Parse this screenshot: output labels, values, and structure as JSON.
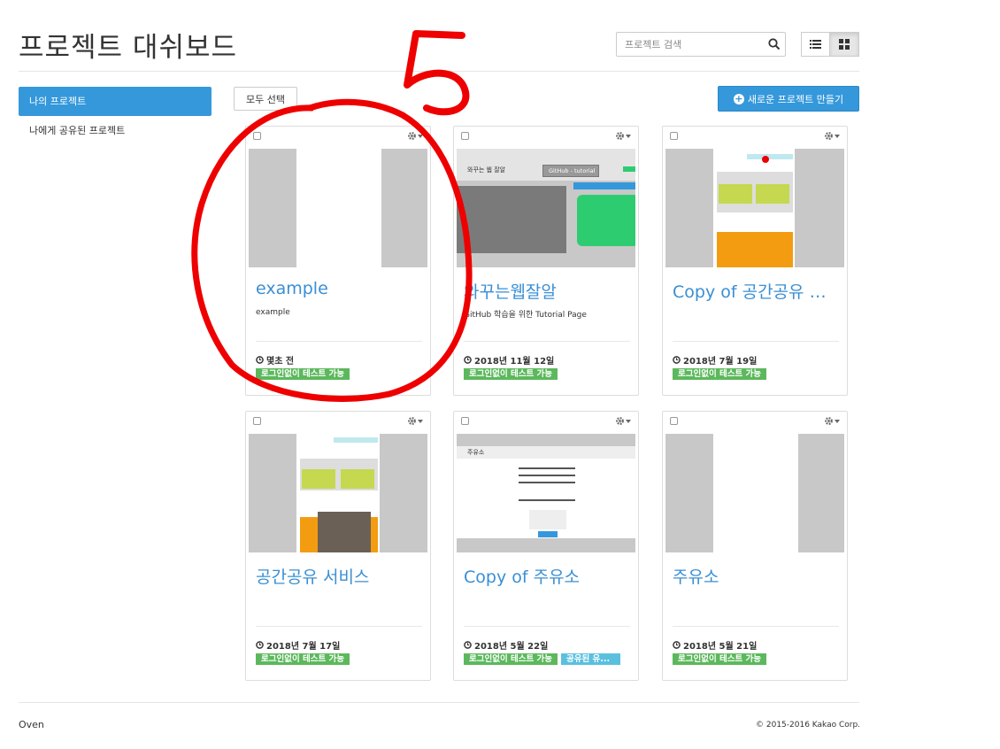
{
  "header": {
    "title": "프로젝트 대쉬보드",
    "search_placeholder": "프로젝트 검색"
  },
  "sidebar": {
    "items": [
      {
        "label": "나의 프로젝트",
        "active": true
      },
      {
        "label": "나에게 공유된 프로젝트",
        "active": false
      }
    ]
  },
  "toolbar": {
    "select_all_label": "모두 선택",
    "new_project_label": "새로운 프로젝트 만들기"
  },
  "cards": [
    {
      "title": "example",
      "description": "example",
      "date": "몇초 전",
      "tags": [
        "로그인없이 테스트 가능"
      ]
    },
    {
      "title": "와꾸는웹잘알",
      "description": "GitHub 학습을 위한 Tutorial Page",
      "date": "2018년 11월 12일",
      "tags": [
        "로그인없이 테스트 가능"
      ]
    },
    {
      "title": "Copy of 공간공유 서비스",
      "description": "",
      "date": "2018년 7월 19일",
      "tags": [
        "로그인없이 테스트 가능"
      ]
    },
    {
      "title": "공간공유 서비스",
      "description": "",
      "date": "2018년 7월 17일",
      "tags": [
        "로그인없이 테스트 가능"
      ]
    },
    {
      "title": "Copy of 주유소",
      "description": "",
      "date": "2018년 5월 22일",
      "tags": [
        "로그인없이 테스트 가능",
        "공유된 유..."
      ]
    },
    {
      "title": "주유소",
      "description": "",
      "date": "2018년 5월 21일",
      "tags": [
        "로그인없이 테스트 가능"
      ]
    }
  ],
  "thumbnails": {
    "card2": {
      "logo": "와꾸는 웹 잘알",
      "tab": "GitHub - tutorial"
    },
    "card5": {
      "title": "주유소"
    }
  },
  "footer": {
    "left": "Oven",
    "right": "© 2015-2016 Kakao Corp."
  },
  "annotation": {
    "label": "5",
    "color": "#ee0000"
  },
  "colors": {
    "accent": "#3498db",
    "link": "#3a8fd4",
    "tag_green": "#5cb85c",
    "tag_blue": "#5bc0de"
  }
}
